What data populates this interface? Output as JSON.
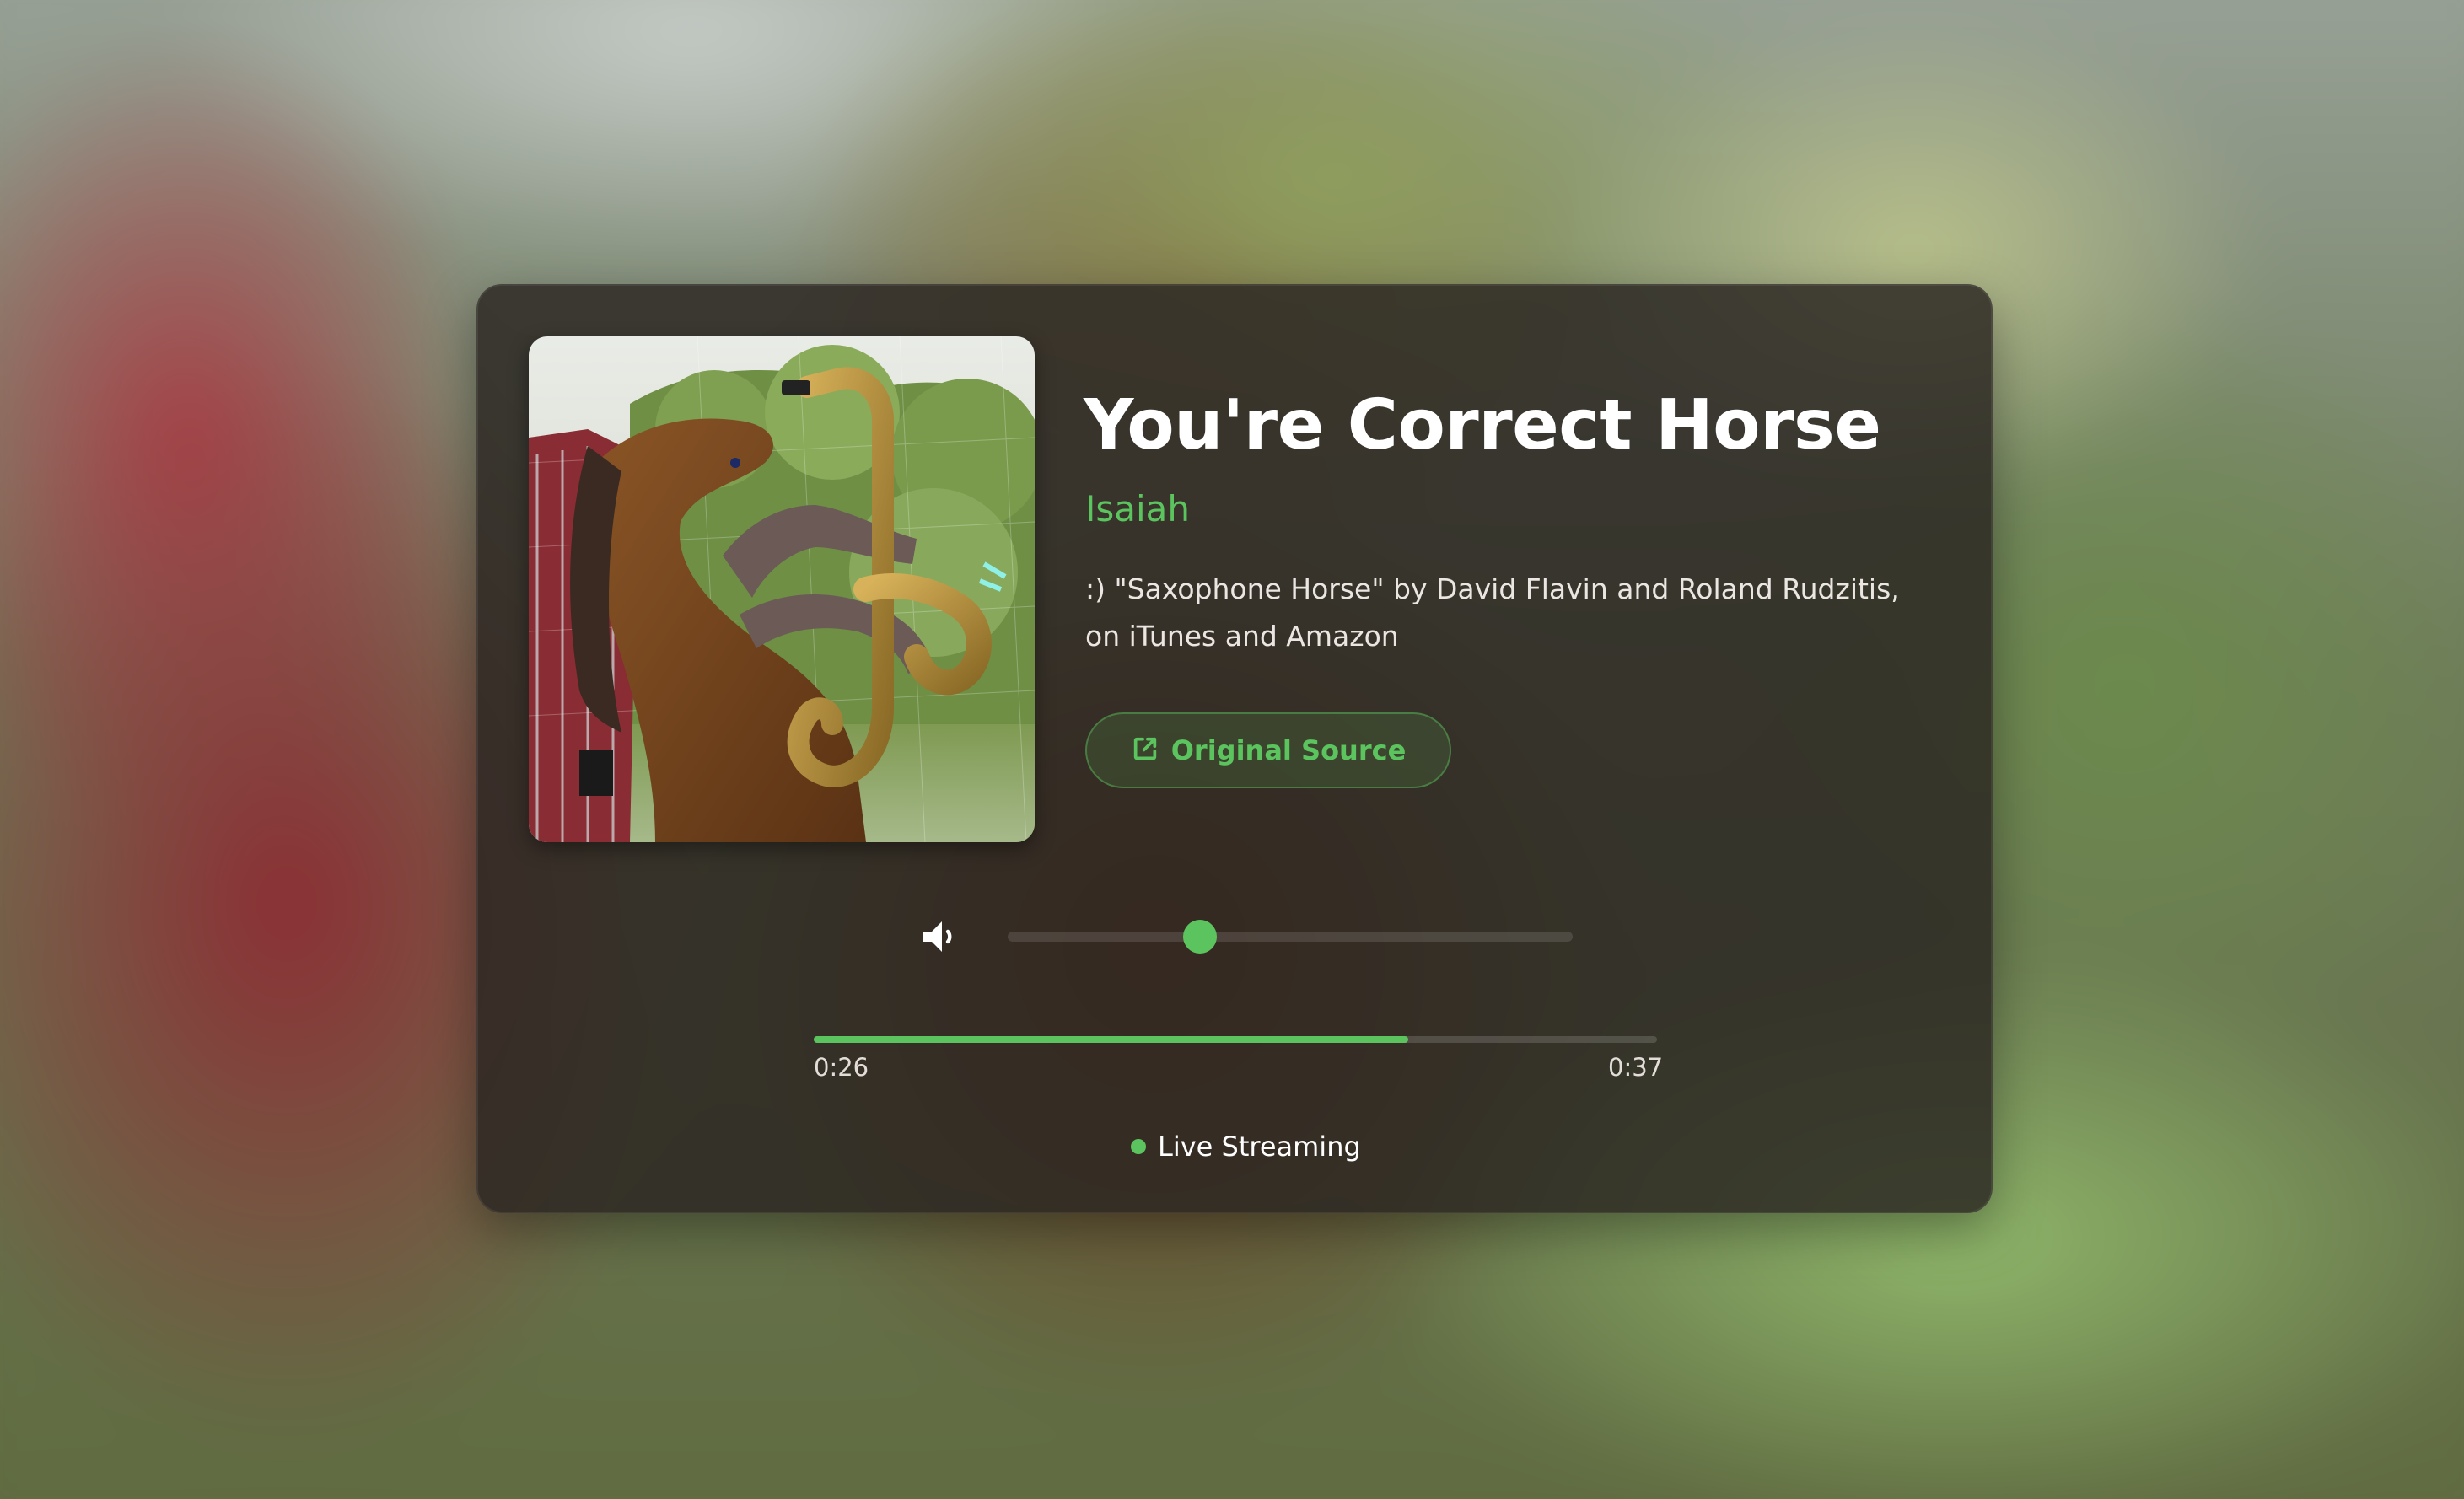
{
  "track": {
    "title": "You're Correct Horse",
    "artist": "Isaiah",
    "description": ":) \"Saxophone Horse\" by David Flavin and Roland Rudzitis, on iTunes and Amazon",
    "source_label": "Original Source"
  },
  "player": {
    "volume_fraction": 0.34,
    "progress_fraction": 0.705,
    "time_current": "0:26",
    "time_total": "0:37"
  },
  "status": {
    "label": "Live Streaming"
  },
  "colors": {
    "accent": "#5cc45e",
    "card": "#2a2421"
  },
  "icons": {
    "source": "external-link-icon",
    "volume": "volume-icon"
  }
}
